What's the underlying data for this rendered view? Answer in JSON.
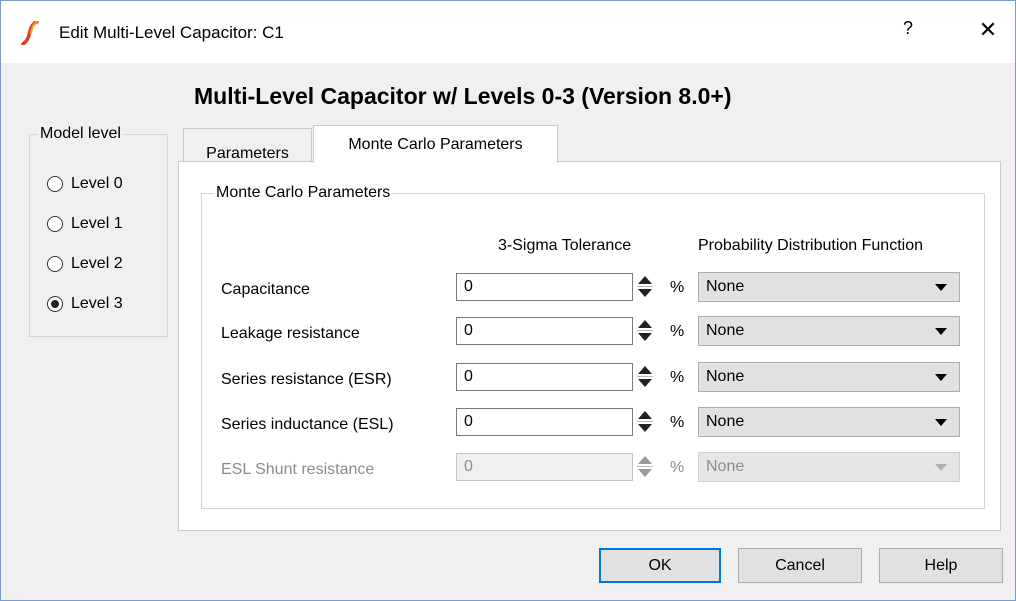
{
  "window": {
    "title": "Edit Multi-Level Capacitor: C1",
    "help_glyph": "?",
    "close_glyph": "✕",
    "icon": "simetrix-logo-icon"
  },
  "heading": "Multi-Level Capacitor w/ Levels 0-3 (Version 8.0+)",
  "model_level": {
    "title": "Model level",
    "options": [
      {
        "label": "Level 0",
        "checked": false
      },
      {
        "label": "Level 1",
        "checked": false
      },
      {
        "label": "Level 2",
        "checked": false
      },
      {
        "label": "Level 3",
        "checked": true
      }
    ]
  },
  "tabs": [
    {
      "label": "Parameters",
      "active": false
    },
    {
      "label": "Monte Carlo Parameters",
      "active": true
    }
  ],
  "monte_carlo": {
    "group_title": "Monte Carlo Parameters",
    "col_tolerance": "3-Sigma Tolerance",
    "col_distribution": "Probability Distribution Function",
    "percent_symbol": "%",
    "rows": [
      {
        "label": "Capacitance",
        "tolerance": "0",
        "distribution": "None",
        "enabled": true
      },
      {
        "label": "Leakage resistance",
        "tolerance": "0",
        "distribution": "None",
        "enabled": true
      },
      {
        "label": "Series resistance (ESR)",
        "tolerance": "0",
        "distribution": "None",
        "enabled": true
      },
      {
        "label": "Series inductance (ESL)",
        "tolerance": "0",
        "distribution": "None",
        "enabled": true
      },
      {
        "label": "ESL Shunt resistance",
        "tolerance": "0",
        "distribution": "None",
        "enabled": false
      }
    ]
  },
  "buttons": {
    "ok": "OK",
    "cancel": "Cancel",
    "help": "Help"
  },
  "colors": {
    "accent": "#0078d7",
    "logo_orange": "#f7a21b",
    "logo_red": "#e03a1e"
  }
}
